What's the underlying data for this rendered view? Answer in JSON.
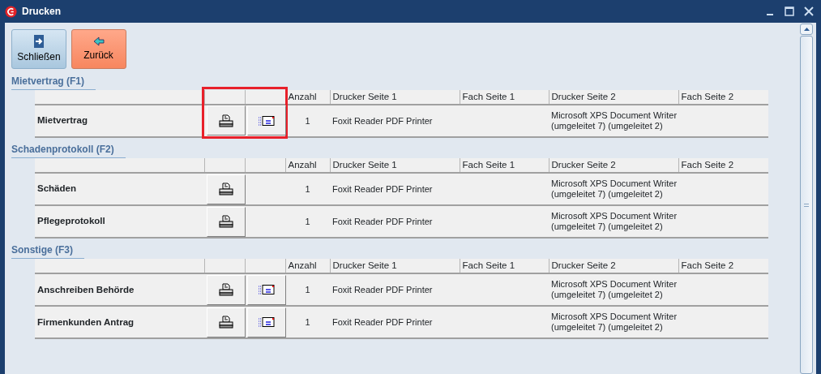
{
  "window": {
    "title": "Drucken"
  },
  "toolbar": [
    {
      "label": "Schließen",
      "kind": "close"
    },
    {
      "label": "Zurück",
      "kind": "back"
    }
  ],
  "sections": [
    {
      "title": "Mietvertrag (F1)",
      "highlighted": true,
      "columns": [
        "Anzahl",
        "Drucker Seite 1",
        "Fach Seite 1",
        "Drucker Seite 2",
        "Fach Seite 2"
      ],
      "rows": [
        {
          "name": "Mietvertrag",
          "email": true,
          "anzahl": "1",
          "drucker_1": "Foxit Reader PDF Printer",
          "drucker_2": "Microsoft XPS Document Writer (umgeleitet 7) (umgeleitet 2)"
        }
      ]
    },
    {
      "title": "Schadenprotokoll (F2)",
      "highlighted": false,
      "columns": [
        "Anzahl",
        "Drucker Seite 1",
        "Fach Seite 1",
        "Drucker Seite 2",
        "Fach Seite 2"
      ],
      "rows": [
        {
          "name": "Schäden",
          "email": false,
          "anzahl": "1",
          "drucker_1": "Foxit Reader PDF Printer",
          "drucker_2": "Microsoft XPS Document Writer (umgeleitet 7) (umgeleitet 2)"
        },
        {
          "name": "Pflegeprotokoll",
          "email": false,
          "anzahl": "1",
          "drucker_1": "Foxit Reader PDF Printer",
          "drucker_2": "Microsoft XPS Document Writer (umgeleitet 7) (umgeleitet 2)"
        }
      ]
    },
    {
      "title": "Sonstige (F3)",
      "highlighted": false,
      "columns": [
        "Anzahl",
        "Drucker Seite 1",
        "Fach Seite 1",
        "Drucker Seite 2",
        "Fach Seite 2"
      ],
      "rows": [
        {
          "name": "Anschreiben Behörde",
          "email": true,
          "anzahl": "1",
          "drucker_1": "Foxit Reader PDF Printer",
          "drucker_2": "Microsoft XPS Document Writer (umgeleitet 7) (umgeleitet 2)"
        },
        {
          "name": "Firmenkunden Antrag",
          "email": true,
          "anzahl": "1",
          "drucker_1": "Foxit Reader PDF Printer",
          "drucker_2": "Microsoft XPS Document Writer (umgeleitet 7) (umgeleitet 2)"
        }
      ]
    }
  ]
}
